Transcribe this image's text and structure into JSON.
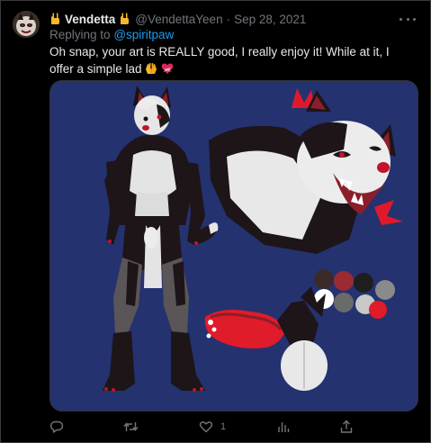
{
  "tweet": {
    "display_name": "Vendetta",
    "name_emoji": "horns",
    "handle": "@VendettaYeen",
    "separator": "·",
    "date": "Sep 28, 2021",
    "replying_prefix": "Replying to",
    "replying_handle": "@spiritpaw",
    "text": "Oh snap, your art is REALLY good, I really enjoy it! While at it, I offer a simple lad",
    "text_emojis": [
      "raising-hands",
      "heart-with-ribbon"
    ]
  },
  "actions": {
    "reply_count": "",
    "retweet_count": "",
    "like_count": "1",
    "views_count": ""
  },
  "media": {
    "background_color": "#253270",
    "palette_swatches": [
      "#3a2a2a",
      "#9b2b33",
      "#1e1e1e",
      "#c8c8c8",
      "#6a6a6a",
      "#e01b2a",
      "#ffffff",
      "#8a8a8a"
    ]
  },
  "colors": {
    "link": "#1d9bf0",
    "muted": "#71767b",
    "text": "#e7e9ea",
    "background": "#000000"
  }
}
